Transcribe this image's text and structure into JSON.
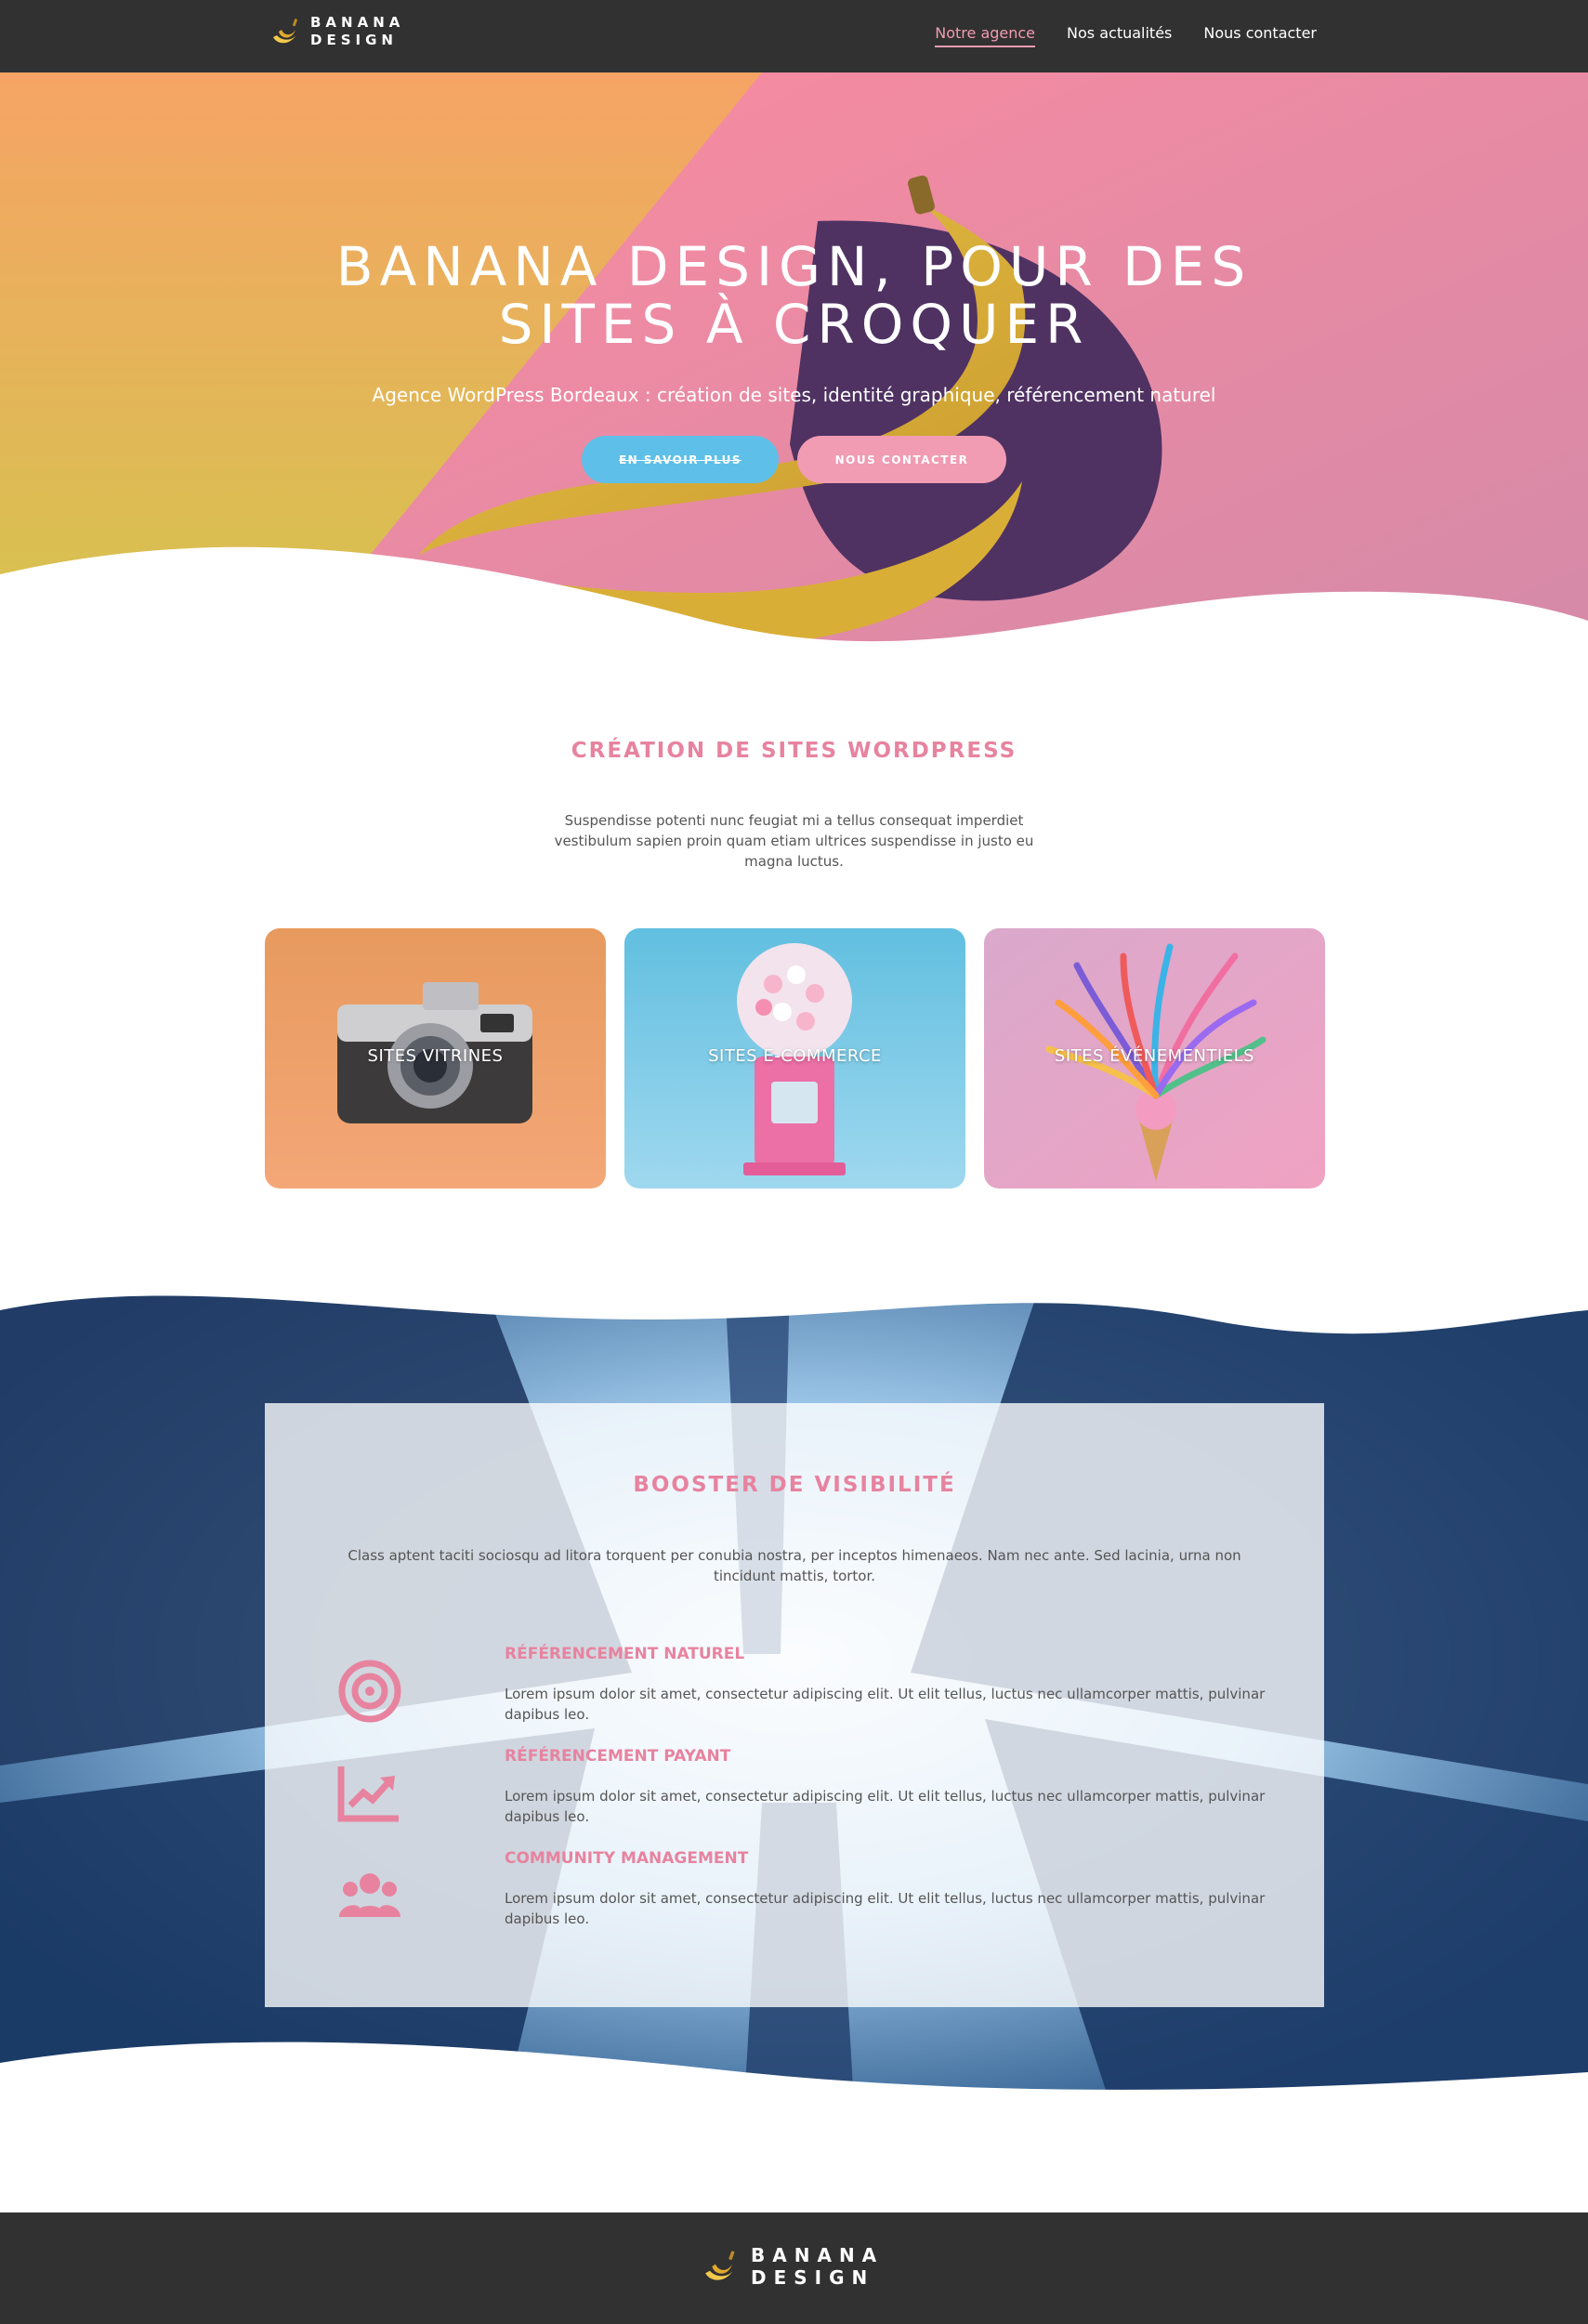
{
  "brand": {
    "line1": "BANANA",
    "line2": "DESIGN"
  },
  "nav": {
    "items": [
      {
        "label": "Notre agence"
      },
      {
        "label": "Nos actualités"
      },
      {
        "label": "Nous contacter"
      }
    ]
  },
  "hero": {
    "title_line1": "BANANA DESIGN, POUR DES",
    "title_line2": "SITES À CROQUER",
    "subtitle": "Agence WordPress Bordeaux : création de sites, identité graphique, référencement naturel",
    "btn_more": "EN SAVOIR PLUS",
    "btn_contact": "NOUS CONTACTER"
  },
  "creation": {
    "title": "CRÉATION DE SITES WORDPRESS",
    "text": "Suspendisse potenti nunc feugiat mi a tellus consequat imperdiet vestibulum sapien proin quam etiam ultrices suspendisse in justo eu magna luctus.",
    "cards": [
      {
        "label": "SITES VITRINES"
      },
      {
        "label": "SITES E-COMMERCE"
      },
      {
        "label": "SITES ÉVÉNEMENTIELS"
      }
    ]
  },
  "visibility": {
    "title": "BOOSTER DE VISIBILITÉ",
    "text": "Class aptent taciti sociosqu ad litora torquent per conubia nostra, per inceptos himenaeos. Nam nec ante. Sed lacinia, urna non tincidunt mattis, tortor.",
    "features": [
      {
        "icon": "target-icon",
        "title": "RÉFÉRENCEMENT NATUREL",
        "text": "Lorem ipsum dolor sit amet, consectetur adipiscing elit. Ut elit tellus, luctus nec ullamcorper mattis, pulvinar dapibus leo."
      },
      {
        "icon": "chart-trend-icon",
        "title": "RÉFÉRENCEMENT PAYANT",
        "text": "Lorem ipsum dolor sit amet, consectetur adipiscing elit. Ut elit tellus, luctus nec ullamcorper mattis, pulvinar dapibus leo."
      },
      {
        "icon": "users-icon",
        "title": "COMMUNITY MANAGEMENT",
        "text": "Lorem ipsum dolor sit amet, consectetur adipiscing elit. Ut elit tellus, luctus nec ullamcorper mattis, pulvinar dapibus leo."
      }
    ]
  },
  "colors": {
    "accent_pink": "#e7839f",
    "button_blue": "#5ec0e8",
    "button_pink": "#f19cb3",
    "dark_bar": "#313131"
  }
}
